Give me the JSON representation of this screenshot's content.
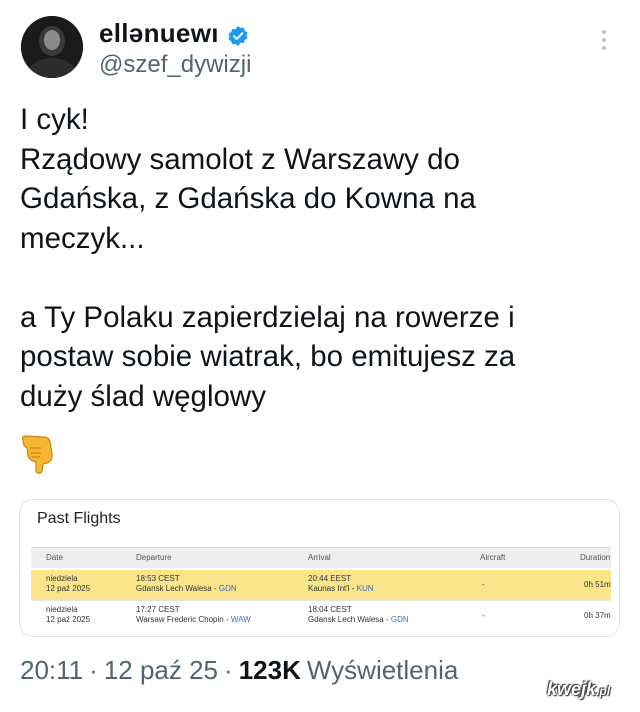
{
  "author": {
    "display_name": "ellənuewı",
    "handle": "@szef_dywizji"
  },
  "tweet": {
    "text": "I cyk!\nRządowy samolot z Warszawy do\nGdańska, z Gdańska do Kowna na\nmeczyk...\n\na Ty Polaku zapierdzielaj na rowerze i\npostaw sobie wiatrak, bo emitujesz za\nduży ślad węglowy",
    "emoji": "backhand-index-pointing-down"
  },
  "card": {
    "title": "Past Flights",
    "columns": [
      "Date",
      "Departure",
      "Arrival",
      "Aircraft",
      "Duration"
    ],
    "rows": [
      {
        "date_day": "niedziela",
        "date": "12 paź 2025",
        "dep_time": "18:53 CEST",
        "dep_airport": "Gdansk Lech Walesa - ",
        "dep_code": "GDN",
        "arr_time": "20:44 EEST",
        "arr_airport": "Kaunas Int'l - ",
        "arr_code": "KUN",
        "aircraft": "-",
        "duration": "0h 51m",
        "highlighted": true
      },
      {
        "date_day": "niedziela",
        "date": "12 paź 2025",
        "dep_time": "17:27 CEST",
        "dep_airport": "Warsaw Frederic Chopin - ",
        "dep_code": "WAW",
        "arr_time": "18:04 CEST",
        "arr_airport": "Gdansk Lech Walesa - ",
        "arr_code": "GDN",
        "aircraft": "-",
        "duration": "0h 37m",
        "highlighted": false
      }
    ]
  },
  "footer": {
    "time": "20:11",
    "separator": "·",
    "date": "12 paź 25",
    "views_count": "123K",
    "views_label": "Wyświetlenia"
  },
  "watermark": {
    "text": "kwejk",
    "suffix": ".pl"
  },
  "colors": {
    "verified": "#1d9bf0",
    "highlight_row": "#fbe58b",
    "secondary_text": "#536471",
    "airport_code": "#3e6fb5"
  }
}
